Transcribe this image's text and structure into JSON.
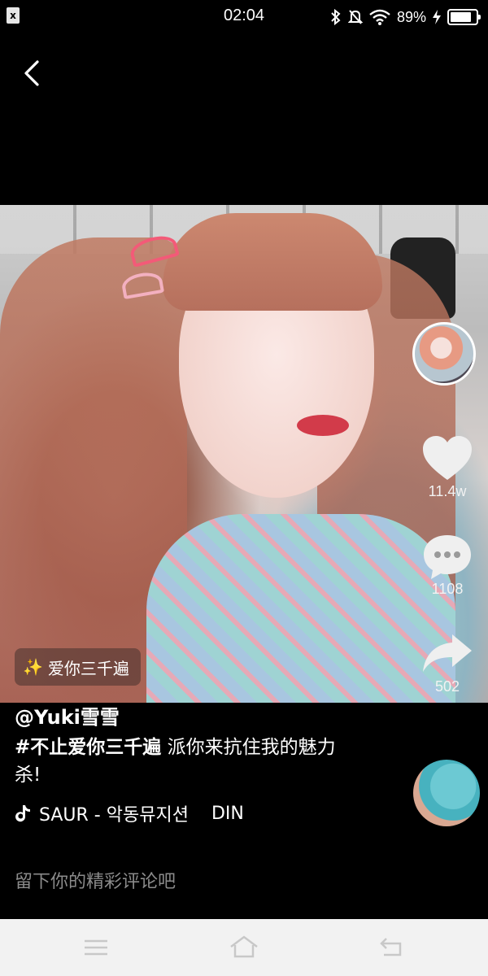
{
  "status": {
    "notification_glyph": "x",
    "time": "02:04",
    "battery": "89%",
    "icons": [
      "bluetooth-icon",
      "mute-bell-icon",
      "wifi-icon",
      "charging-icon",
      "battery-icon"
    ]
  },
  "video": {
    "music_tag": "爱你三千遍"
  },
  "rail": {
    "likes": "11.4w",
    "comments": "1108",
    "shares": "502"
  },
  "post": {
    "author": "@Yuki雪雪",
    "hashtag": "#不止爱你三千遍",
    "caption_rest": " 派你来抗住我的魅力杀!",
    "music_name": "SAUR - 악동뮤지션",
    "music_extra": "DIN"
  },
  "comment_input": {
    "placeholder": "留下你的精彩评论吧"
  },
  "colors": {
    "background": "#000000",
    "navbar": "#f2f2f2",
    "placeholder": "#8b8b8b"
  }
}
